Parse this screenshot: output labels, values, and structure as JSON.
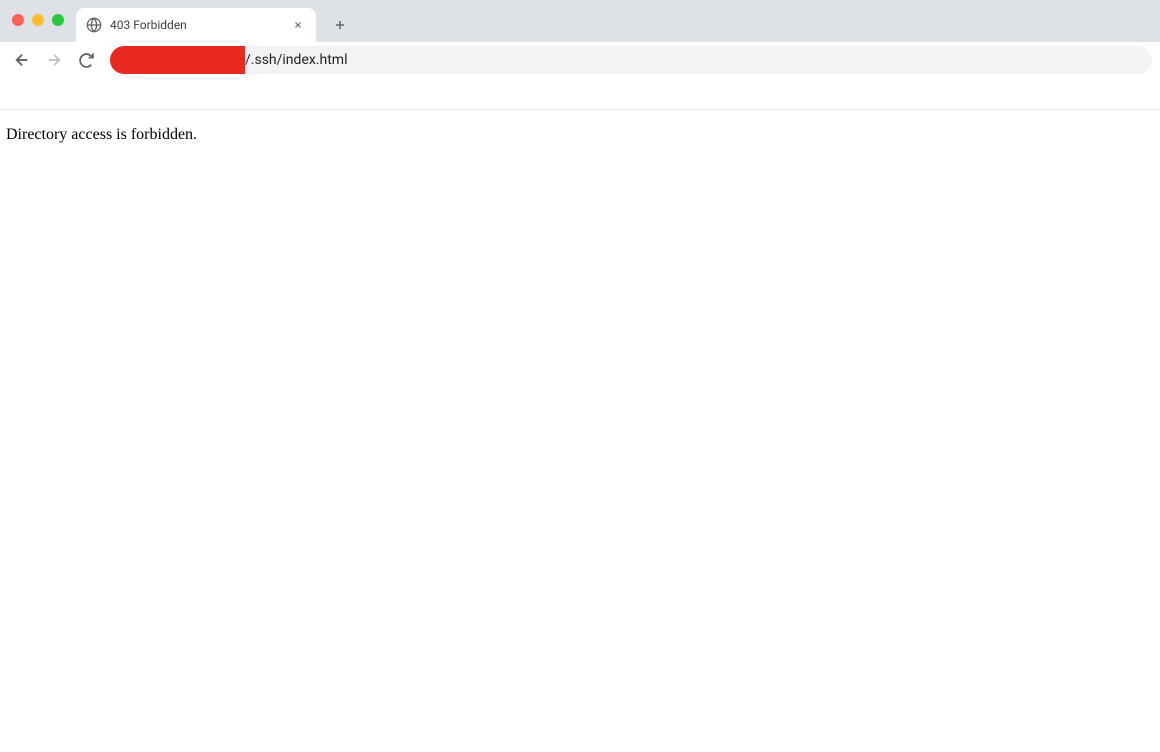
{
  "browser": {
    "tab_title": "403 Forbidden",
    "url_visible_suffix": "/.ssh/index.html"
  },
  "page": {
    "message": "Directory access is forbidden."
  }
}
